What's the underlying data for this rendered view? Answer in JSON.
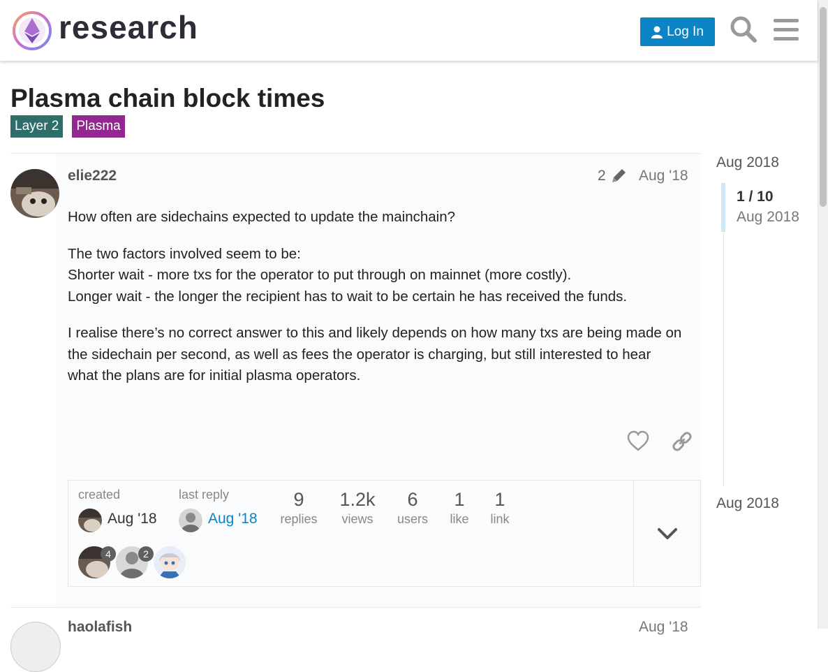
{
  "header": {
    "logo_text": "research",
    "login_label": "Log In"
  },
  "topic": {
    "title": "Plasma chain block times",
    "tags": [
      "Layer 2",
      "Plasma"
    ]
  },
  "post": {
    "username": "elie222",
    "edit_count": "2",
    "date": "Aug '18",
    "paragraphs": [
      "How often are sidechains expected to update the mainchain?",
      "The two factors involved seem to be:",
      "Shorter wait - more txs for the operator to put through on mainnet (more costly).",
      "Longer wait - the longer the recipient has to wait to be certain he has received the funds.",
      "I realise there’s no correct answer to this and likely depends on how many txs are being made on the sidechain per second, as well as fees the operator is charging, but still interested to hear what the plans are for initial plasma operators."
    ]
  },
  "topic_map": {
    "created_label": "created",
    "created_date": "Aug '18",
    "last_reply_label": "last reply",
    "last_reply_date": "Aug '18",
    "stats": [
      {
        "num": "9",
        "label": "replies"
      },
      {
        "num": "1.2k",
        "label": "views"
      },
      {
        "num": "6",
        "label": "users"
      },
      {
        "num": "1",
        "label": "like"
      },
      {
        "num": "1",
        "label": "link"
      }
    ],
    "participant_counts": [
      "4",
      "2"
    ]
  },
  "next_post": {
    "username": "haolafish",
    "date": "Aug '18"
  },
  "timeline": {
    "start": "Aug 2018",
    "position": "1 / 10",
    "position_date": "Aug 2018",
    "end": "Aug 2018"
  },
  "colors": {
    "accent": "#0a84c4",
    "tag_layer2": "#2d6e6b",
    "tag_plasma": "#92278f"
  }
}
